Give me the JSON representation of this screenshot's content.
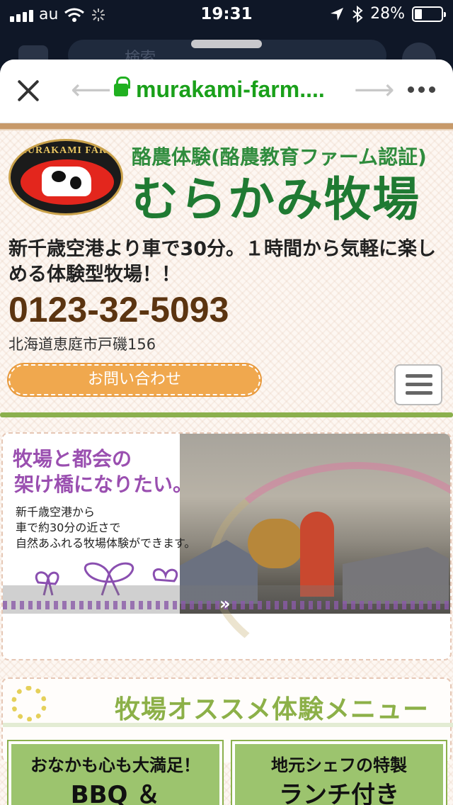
{
  "status_bar": {
    "carrier": "au",
    "time": "19:31",
    "battery_percent": "28%",
    "battery_level": 0.28
  },
  "behind_sheet": {
    "search_placeholder": "検索"
  },
  "browser": {
    "url": "murakami-farm....",
    "icons": [
      "close-icon",
      "back-arrow-icon",
      "lock-icon",
      "forward-arrow-icon",
      "more-icon"
    ]
  },
  "header": {
    "logo_text": "MURAKAMI FARM",
    "subtitle": "酪農体験(酪農教育ファーム認証)",
    "title": "むらかみ牧場",
    "tagline": "新千歳空港より車で30分。１時間から気軽に楽しめる体験型牧場！！",
    "phone": "0123-32-5093",
    "address": "北海道恵庭市戸磯156",
    "contact_button": "お問い合わせ"
  },
  "hero": {
    "headline_line1": "牧場と都会の",
    "headline_line2": "架け橋になりたい。",
    "body_line1": "新千歳空港から",
    "body_line2": "車で約30分の近さで",
    "body_line3": "自然あふれる牧場体験ができます。",
    "next_label": "»"
  },
  "menu_section": {
    "title": "牧場オススメ体験メニュー",
    "cards": [
      {
        "line1": "おなかも心も大満足！",
        "line2": "BBQ ＆"
      },
      {
        "line1": "地元シェフの特製",
        "line2": "ランチ付き"
      }
    ]
  },
  "colors": {
    "brand_green": "#1f7a32",
    "accent_orange": "#f0a84e",
    "phone_brown": "#5b3410",
    "hero_purple": "#9a4fb0",
    "menu_green": "#8cb048",
    "url_green": "#1aa01a"
  }
}
